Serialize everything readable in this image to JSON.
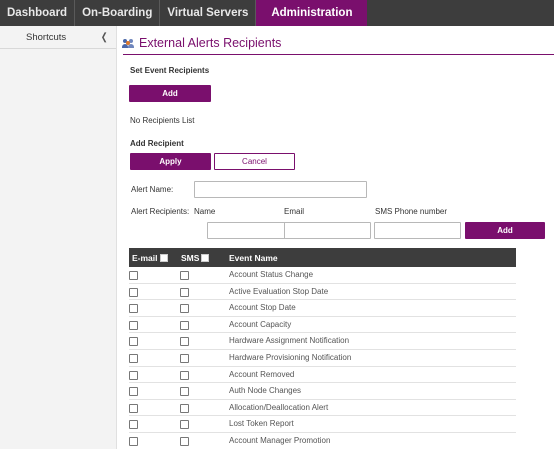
{
  "nav": {
    "tabs": [
      {
        "label": "Dashboard"
      },
      {
        "label": "On-Boarding"
      },
      {
        "label": "Virtual Servers"
      },
      {
        "label": "Administration"
      }
    ]
  },
  "sidebar": {
    "shortcuts_label": "Shortcuts",
    "collapse_icon": "chevron-left-icon"
  },
  "page": {
    "title": "External Alerts Recipients",
    "title_icon": "users-icon"
  },
  "set_event_recipients": {
    "heading": "Set Event Recipients",
    "add_label": "Add",
    "empty_text": "No Recipients List"
  },
  "add_recipient": {
    "heading": "Add Recipient",
    "apply_label": "Apply",
    "cancel_label": "Cancel",
    "alert_name_label": "Alert Name:",
    "alert_name_value": "",
    "alert_recipients_label": "Alert Recipients:",
    "col_name": "Name",
    "col_email": "Email",
    "col_sms": "SMS Phone number",
    "name_value": "",
    "email_value": "",
    "sms_value": "",
    "add_label": "Add"
  },
  "events_table": {
    "headers": {
      "email": "E-mail",
      "sms": "SMS",
      "event": "Event Name"
    },
    "rows": [
      {
        "event": "Account Status Change",
        "email": false,
        "sms": false
      },
      {
        "event": "Active Evaluation Stop Date",
        "email": false,
        "sms": false
      },
      {
        "event": "Account Stop Date",
        "email": false,
        "sms": false
      },
      {
        "event": "Account Capacity",
        "email": false,
        "sms": false
      },
      {
        "event": "Hardware Assignment Notification",
        "email": false,
        "sms": false
      },
      {
        "event": "Hardware Provisioning Notification",
        "email": false,
        "sms": false
      },
      {
        "event": "Account Removed",
        "email": false,
        "sms": false
      },
      {
        "event": "Auth Node Changes",
        "email": false,
        "sms": false
      },
      {
        "event": "Allocation/Deallocation Alert",
        "email": false,
        "sms": false
      },
      {
        "event": "Lost Token Report",
        "email": false,
        "sms": false
      },
      {
        "event": "Account Manager Promotion",
        "email": false,
        "sms": false
      }
    ]
  },
  "colors": {
    "accent": "#7a0f6d",
    "nav_bg": "#3d3d3d",
    "sidebar_bg": "#f3f3f3"
  }
}
